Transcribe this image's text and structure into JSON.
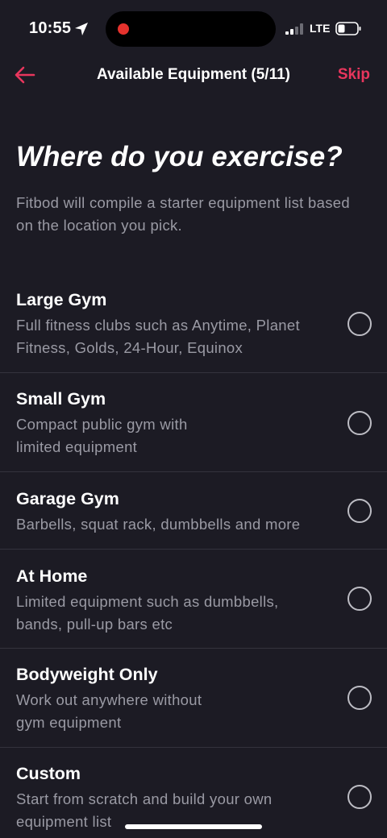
{
  "status_bar": {
    "time": "10:55",
    "network": "LTE",
    "icons": [
      "location-arrow-icon",
      "signal-bars-icon",
      "battery-icon"
    ]
  },
  "header": {
    "title": "Available Equipment (5/11)",
    "back_icon": "arrow-left-icon",
    "skip_label": "Skip"
  },
  "main": {
    "heading": "Where do you exercise?",
    "subtext": "Fitbod will compile a starter equipment list based on the location you pick."
  },
  "options": [
    {
      "title": "Large Gym",
      "desc_lines": [
        "Full fitness clubs such as Anytime, Planet",
        "Fitness, Golds, 24-Hour, Equinox"
      ],
      "selected": false
    },
    {
      "title": "Small Gym",
      "desc_lines": [
        "Compact public gym with",
        "limited equipment"
      ],
      "selected": false
    },
    {
      "title": "Garage Gym",
      "desc_lines": [
        "Barbells, squat rack, dumbbells and more"
      ],
      "selected": false
    },
    {
      "title": "At Home",
      "desc_lines": [
        "Limited equipment such as dumbbells,",
        "bands, pull-up bars etc"
      ],
      "selected": false
    },
    {
      "title": "Bodyweight Only",
      "desc_lines": [
        "Work out anywhere without",
        "gym equipment"
      ],
      "selected": false
    },
    {
      "title": "Custom",
      "desc_lines": [
        "Start from scratch and build your own",
        "equipment list"
      ],
      "selected": false
    }
  ],
  "colors": {
    "background": "#1c1b24",
    "accent": "#e8365d",
    "secondary_text": "#9a9aa4",
    "divider": "#34333d"
  }
}
